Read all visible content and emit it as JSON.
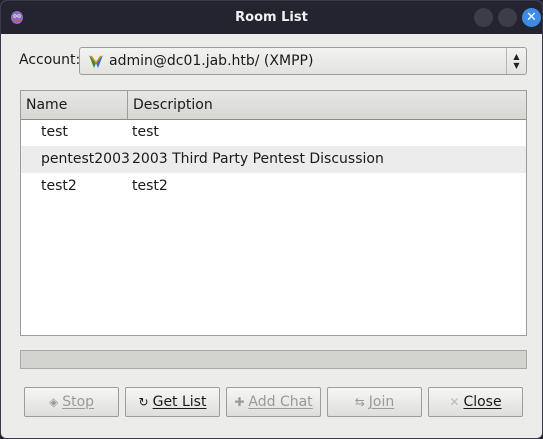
{
  "window": {
    "title": "Room List",
    "close_glyph": "✕"
  },
  "account": {
    "label": "Account:",
    "value": "admin@dc01.jab.htb/ (XMPP)",
    "icon": "xmpp-protocol-icon"
  },
  "room_list": {
    "columns": [
      "Name",
      "Description"
    ],
    "rows": [
      {
        "name": "test",
        "description": "test"
      },
      {
        "name": "pentest2003",
        "description": "2003 Third Party Pentest Discussion"
      },
      {
        "name": "test2",
        "description": "test2"
      }
    ]
  },
  "progress": {
    "fraction": 0
  },
  "buttons": {
    "stop": {
      "label": "Stop",
      "icon": "stop-icon",
      "enabled": false
    },
    "get_list": {
      "label": "Get List",
      "icon": "refresh-icon",
      "enabled": true
    },
    "add_chat": {
      "label": "Add Chat",
      "icon": "add-icon",
      "enabled": false
    },
    "join": {
      "label": "Join",
      "icon": "join-icon",
      "enabled": false
    },
    "close": {
      "label": "Close",
      "icon": "close-icon",
      "enabled": true
    }
  },
  "colors": {
    "accent": "#3c8ce6",
    "titlebar": "#23242f",
    "alt_row": "#ececec"
  }
}
